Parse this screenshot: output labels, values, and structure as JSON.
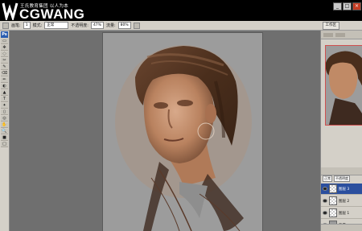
{
  "brand": {
    "tagline": "王氏教育集团 以人为本",
    "name": "CGWANG"
  },
  "window_controls": {
    "minimize": "_",
    "maximize": "□",
    "close": "×"
  },
  "options_bar": {
    "brush_label": "画笔:",
    "brush_size": "1",
    "mode_label": "模式:",
    "mode_value": "正常",
    "opacity_label": "不透明度:",
    "opacity_value": "47%",
    "flow_label": "流量:",
    "flow_value": "80%",
    "workspace": "工作区"
  },
  "toolbox": {
    "badge": "Ps",
    "tools": [
      "▭",
      "✥",
      "◌",
      "✂",
      "✎",
      "⌫",
      "✏",
      "◐",
      "▲",
      "T",
      "✦",
      "▯",
      "◎",
      "✋",
      "🔍",
      "■",
      "□"
    ]
  },
  "layers_panel": {
    "blend_mode": "正常",
    "opacity": "不透明度",
    "layers": [
      {
        "name": "图层 3"
      },
      {
        "name": "图层 2"
      },
      {
        "name": "图层 1"
      },
      {
        "name": "背景"
      }
    ]
  },
  "colors": {
    "canvas_bg": "#9c9c9c",
    "hair": "#5a3a24",
    "skin": "#c08a66",
    "selection": "#2b4f9e"
  }
}
